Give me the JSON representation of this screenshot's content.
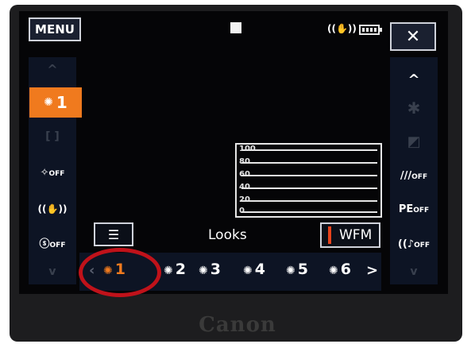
{
  "camera": {
    "brand": "Canon"
  },
  "top_bar": {
    "menu_label": "MENU",
    "close_glyph": "✕",
    "icons": [
      "rec-square-icon",
      "stabilizer-icon",
      "battery-icon"
    ]
  },
  "left_column": {
    "up_glyph": "^",
    "active_look": "1",
    "frame_glyph": "[ ]",
    "f1": "OFF",
    "f2": "((✋))",
    "f3": "OFF",
    "down_glyph": "v"
  },
  "right_column": {
    "up_glyph": "^",
    "f1": "OFF",
    "f2": "OFF",
    "f3": "OFF",
    "down_glyph": "v",
    "peaking_prefix": "PE"
  },
  "waveform": {
    "labels": [
      "100",
      "80",
      "60",
      "40",
      "20",
      "0"
    ]
  },
  "panel": {
    "title": "Looks",
    "wfm_label": "WFM",
    "settings_glyph": "☰"
  },
  "looks": [
    {
      "label": "1",
      "selected": true
    },
    {
      "label": "2",
      "selected": false
    },
    {
      "label": "3",
      "selected": false
    },
    {
      "label": "4",
      "selected": false
    },
    {
      "label": "5",
      "selected": false
    },
    {
      "label": "6",
      "selected": false
    }
  ],
  "nav": {
    "prev": "‹",
    "next": ">"
  },
  "colors": {
    "accent": "#f07a1e",
    "highlight_ring": "#c0121a",
    "wfm_marker": "#e8431c"
  }
}
